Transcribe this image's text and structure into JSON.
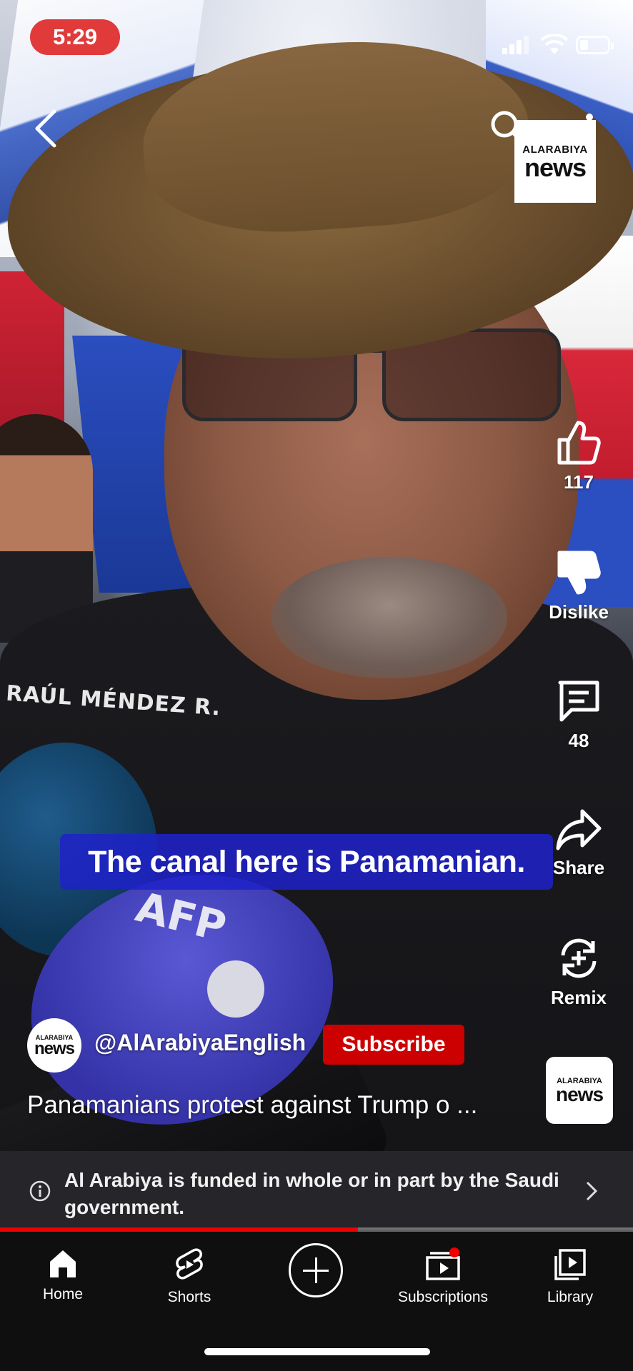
{
  "status_bar": {
    "time": "5:29",
    "battery_level": 0.3
  },
  "channel_logo": {
    "small": "ALARABIYA",
    "big": "news"
  },
  "actions": {
    "like_count": "117",
    "dislike_label": "Dislike",
    "comment_count": "48",
    "share_label": "Share",
    "remix_label": "Remix"
  },
  "video": {
    "caption": "The canal here is Panamanian.",
    "shirt_text": "RAÚL MÉNDEZ R.",
    "mic_text": "AFP"
  },
  "channel": {
    "avatar_small": "ALARABIYA",
    "avatar_big": "news",
    "handle": "@AlArabiyaEnglish",
    "subscribe_label": "Subscribe"
  },
  "title": "Panamanians protest against Trump o ...",
  "sound_thumb": {
    "small": "ALARABIYA",
    "big": "news"
  },
  "info_panel": {
    "text": "Al Arabiya is funded in whole or in part by the Saudi government."
  },
  "progress": {
    "fraction": 0.565
  },
  "nav": {
    "items": [
      {
        "label": "Home",
        "icon": "home-icon"
      },
      {
        "label": "Shorts",
        "icon": "shorts-icon"
      },
      {
        "label": "",
        "icon": "create-icon"
      },
      {
        "label": "Subscriptions",
        "icon": "subscriptions-icon"
      },
      {
        "label": "Library",
        "icon": "library-icon"
      }
    ]
  },
  "colors": {
    "accent": "#cc0000",
    "caption_bg": "#1e22c8",
    "status_pill": "#e03a3a"
  }
}
